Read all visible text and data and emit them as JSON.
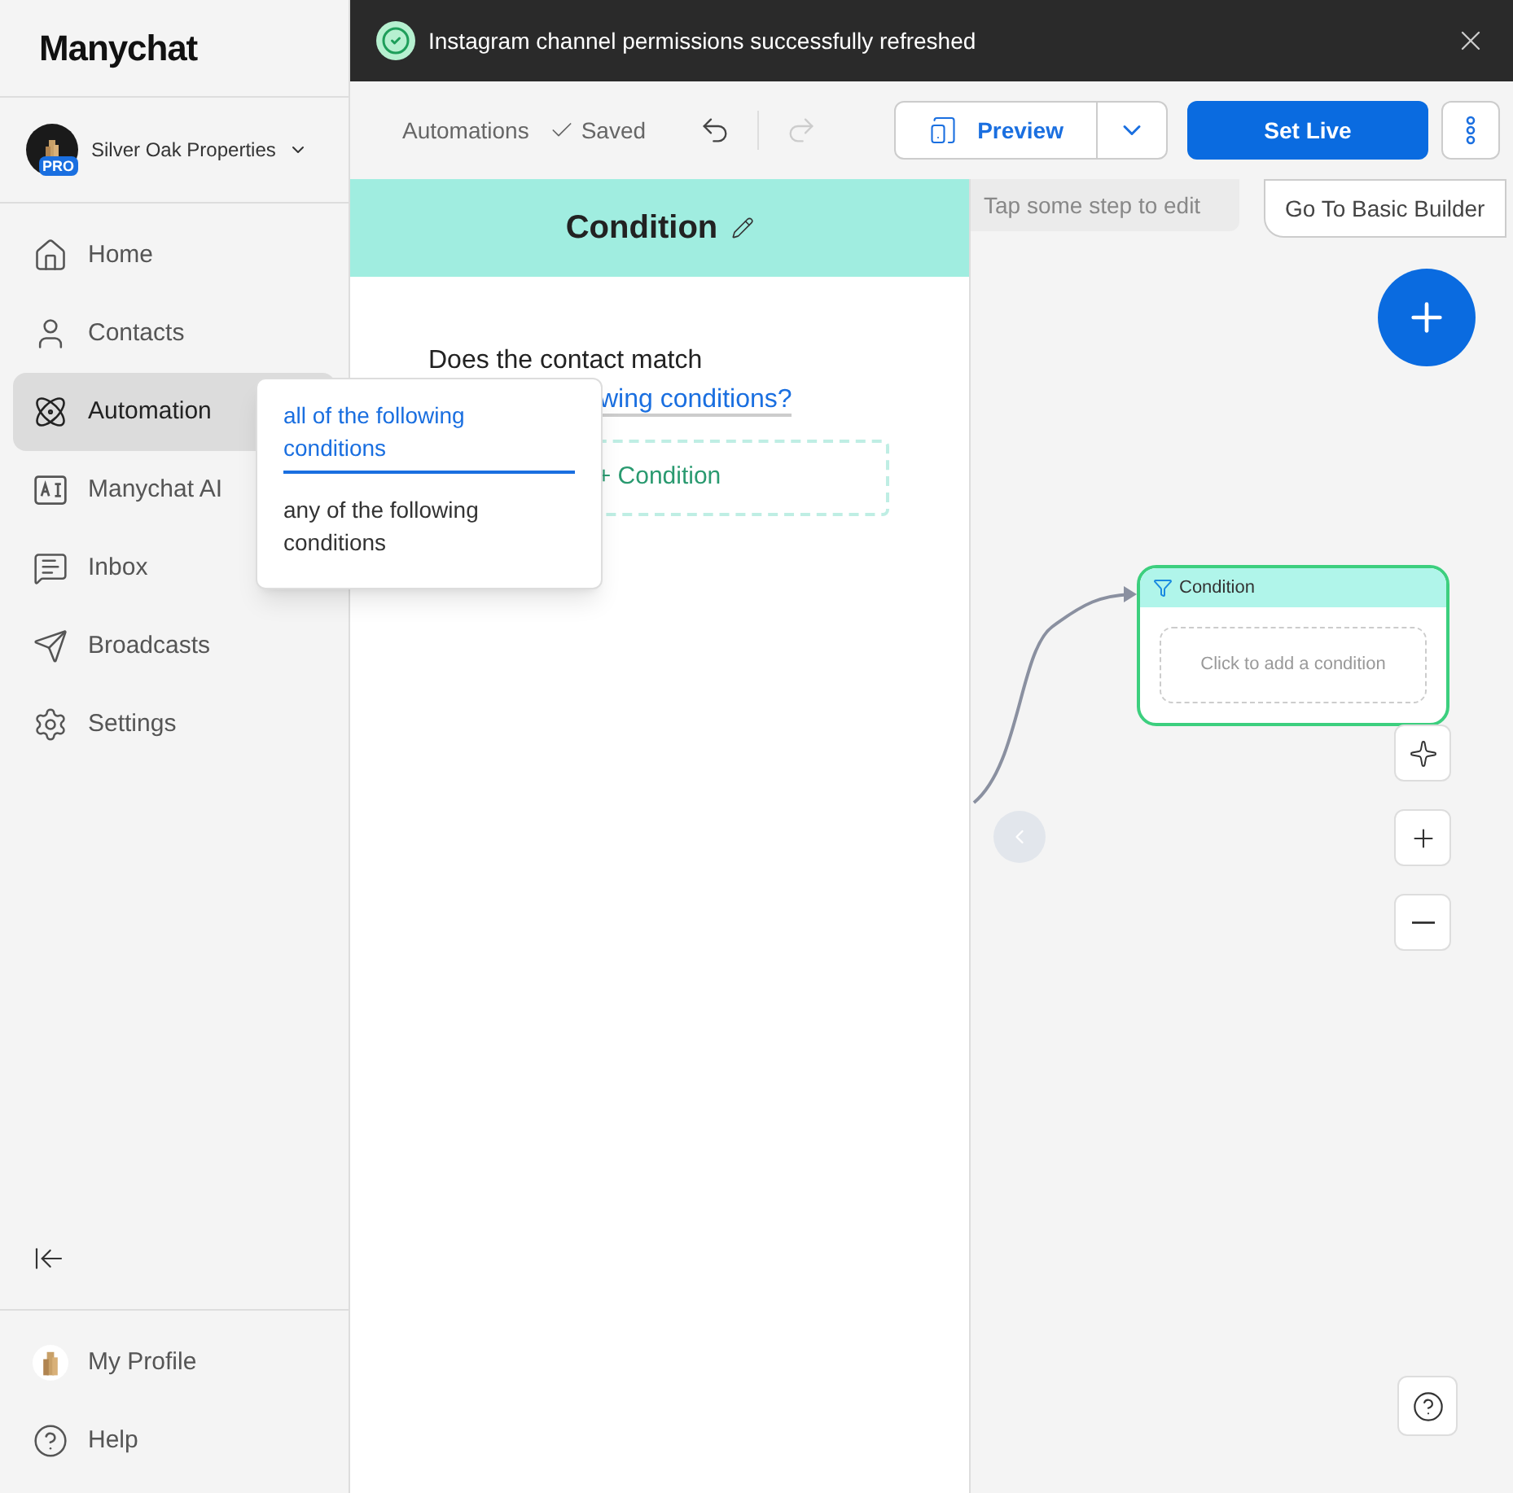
{
  "sidebar": {
    "logo": "Manychat",
    "account": {
      "name": "Silver Oak Properties",
      "badge": "PRO"
    },
    "items": [
      {
        "label": "Home",
        "selected": false
      },
      {
        "label": "Contacts",
        "selected": false
      },
      {
        "label": "Automation",
        "selected": true
      },
      {
        "label": "Manychat AI",
        "selected": false
      },
      {
        "label": "Inbox",
        "selected": false
      },
      {
        "label": "Broadcasts",
        "selected": false
      },
      {
        "label": "Settings",
        "selected": false
      }
    ],
    "footer": [
      {
        "label": "My Profile"
      },
      {
        "label": "Help"
      }
    ]
  },
  "toast": {
    "message": "Instagram channel permissions successfully refreshed"
  },
  "toolbar": {
    "breadcrumb": "Automations",
    "status": "Saved",
    "preview": "Preview",
    "set_live": "Set Live"
  },
  "panel": {
    "title": "Condition",
    "question": "Does the contact match",
    "question_link": "wing conditions?",
    "add": "+ Condition"
  },
  "dropdown": [
    {
      "label": "all of the following conditions",
      "selected": true
    },
    {
      "label": "any of the following conditions",
      "selected": false
    }
  ],
  "canvas": {
    "hint": "Tap some step to edit",
    "basic_builder": "Go To Basic Builder",
    "node": {
      "title": "Condition",
      "placeholder": "Click to add a condition"
    }
  }
}
